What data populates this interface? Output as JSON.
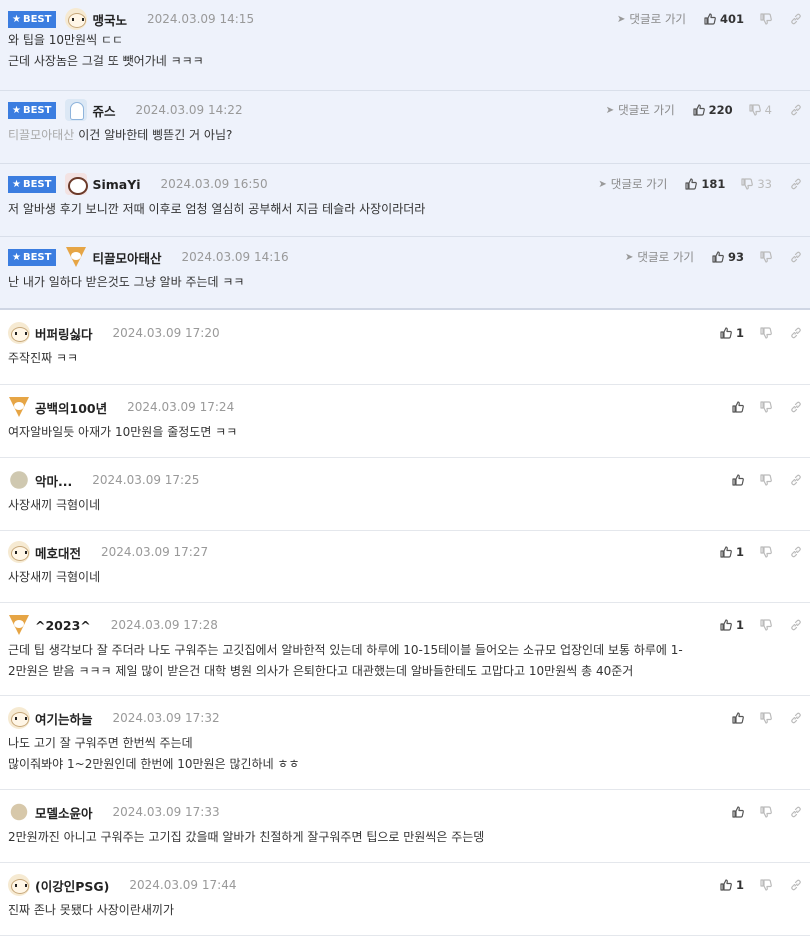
{
  "best_label": "BEST",
  "reply_label": "댓글로 가기",
  "comments": [
    {
      "best": true,
      "avatar": "dog",
      "nick": "맹국노",
      "date": "2024.03.09 14:15",
      "up": "401",
      "down": "",
      "reply": true,
      "lines": [
        "와 팁을 10만원씩 ㄷㄷ",
        "근데 사장놈은 그걸 또 뺏어가네 ㅋㅋㅋ"
      ]
    },
    {
      "best": true,
      "avatar": "ghost",
      "nick": "쥬스",
      "date": "2024.03.09 14:22",
      "up": "220",
      "down": "4",
      "reply": true,
      "quote": "티끌모아태산",
      "lines": [
        "이건 알바한테 삥뜯긴 거 아님?"
      ]
    },
    {
      "best": true,
      "avatar": "monkey",
      "nick": "SimaYi",
      "date": "2024.03.09 16:50",
      "up": "181",
      "down": "33",
      "reply": true,
      "lines": [
        "저 알바생 후기 보니깐 저때 이후로 엄청 열심히 공부해서 지금 테슬라 사장이라더라"
      ]
    },
    {
      "best": true,
      "avatar": "fox",
      "nick": "티끌모아태산",
      "date": "2024.03.09 14:16",
      "up": "93",
      "down": "",
      "reply": true,
      "lines": [
        "난 내가 일하다 받은것도 그냥 알바 주는데 ㅋㅋ"
      ]
    },
    {
      "best": false,
      "avatar": "dog",
      "nick": "버퍼링싫다",
      "date": "2024.03.09 17:20",
      "up": "1",
      "down": "",
      "lines": [
        "주작진짜 ㅋㅋ"
      ]
    },
    {
      "best": false,
      "avatar": "fox",
      "nick": "공백의100년",
      "date": "2024.03.09 17:24",
      "up": "",
      "down": "",
      "lines": [
        "여자알바일듯 아재가 10만원을 줄정도면 ㅋㅋ"
      ]
    },
    {
      "best": false,
      "avatar": "blob",
      "nick": "악마...",
      "date": "2024.03.09 17:25",
      "up": "",
      "down": "",
      "lines": [
        "사장새끼 극혐이네"
      ]
    },
    {
      "best": false,
      "avatar": "dog",
      "nick": "메호대전",
      "date": "2024.03.09 17:27",
      "up": "1",
      "down": "",
      "lines": [
        "사장새끼 극혐이네"
      ]
    },
    {
      "best": false,
      "avatar": "fox",
      "nick": "^2023^",
      "date": "2024.03.09 17:28",
      "up": "1",
      "down": "",
      "lines": [
        "근데 팁 생각보다 잘 주더라 나도 구워주는 고깃집에서 알바한적 있는데 하루에 10-15테이블 들어오는 소규모 업장인데 보통 하루에 1-",
        "2만원은 받음 ㅋㅋㅋ 제일 많이 받은건 대학 병원 의사가 은퇴한다고 대관했는데 알바들한테도 고맙다고 10만원씩 총 40준거"
      ]
    },
    {
      "best": false,
      "avatar": "dog",
      "nick": "여기는하늘",
      "date": "2024.03.09 17:32",
      "up": "",
      "down": "",
      "lines": [
        "나도 고기 잘 구워주면 한번씩 주는데",
        "많이줘봐야 1~2만원인데 한번에 10만원은 많긴하네 ㅎㅎ"
      ]
    },
    {
      "best": false,
      "avatar": "tan",
      "nick": "모델소윤아",
      "date": "2024.03.09 17:33",
      "up": "",
      "down": "",
      "lines": [
        "2만원까진 아니고 구워주는 고기집 갔을때 알바가 친절하게 잘구워주면 팁으로 만원씩은 주는뎅"
      ]
    },
    {
      "best": false,
      "avatar": "dog",
      "nick": "(이강인PSG)",
      "date": "2024.03.09 17:44",
      "up": "1",
      "down": "",
      "lines": [
        "진짜 존나 못됐다 사장이란새끼가"
      ]
    }
  ]
}
